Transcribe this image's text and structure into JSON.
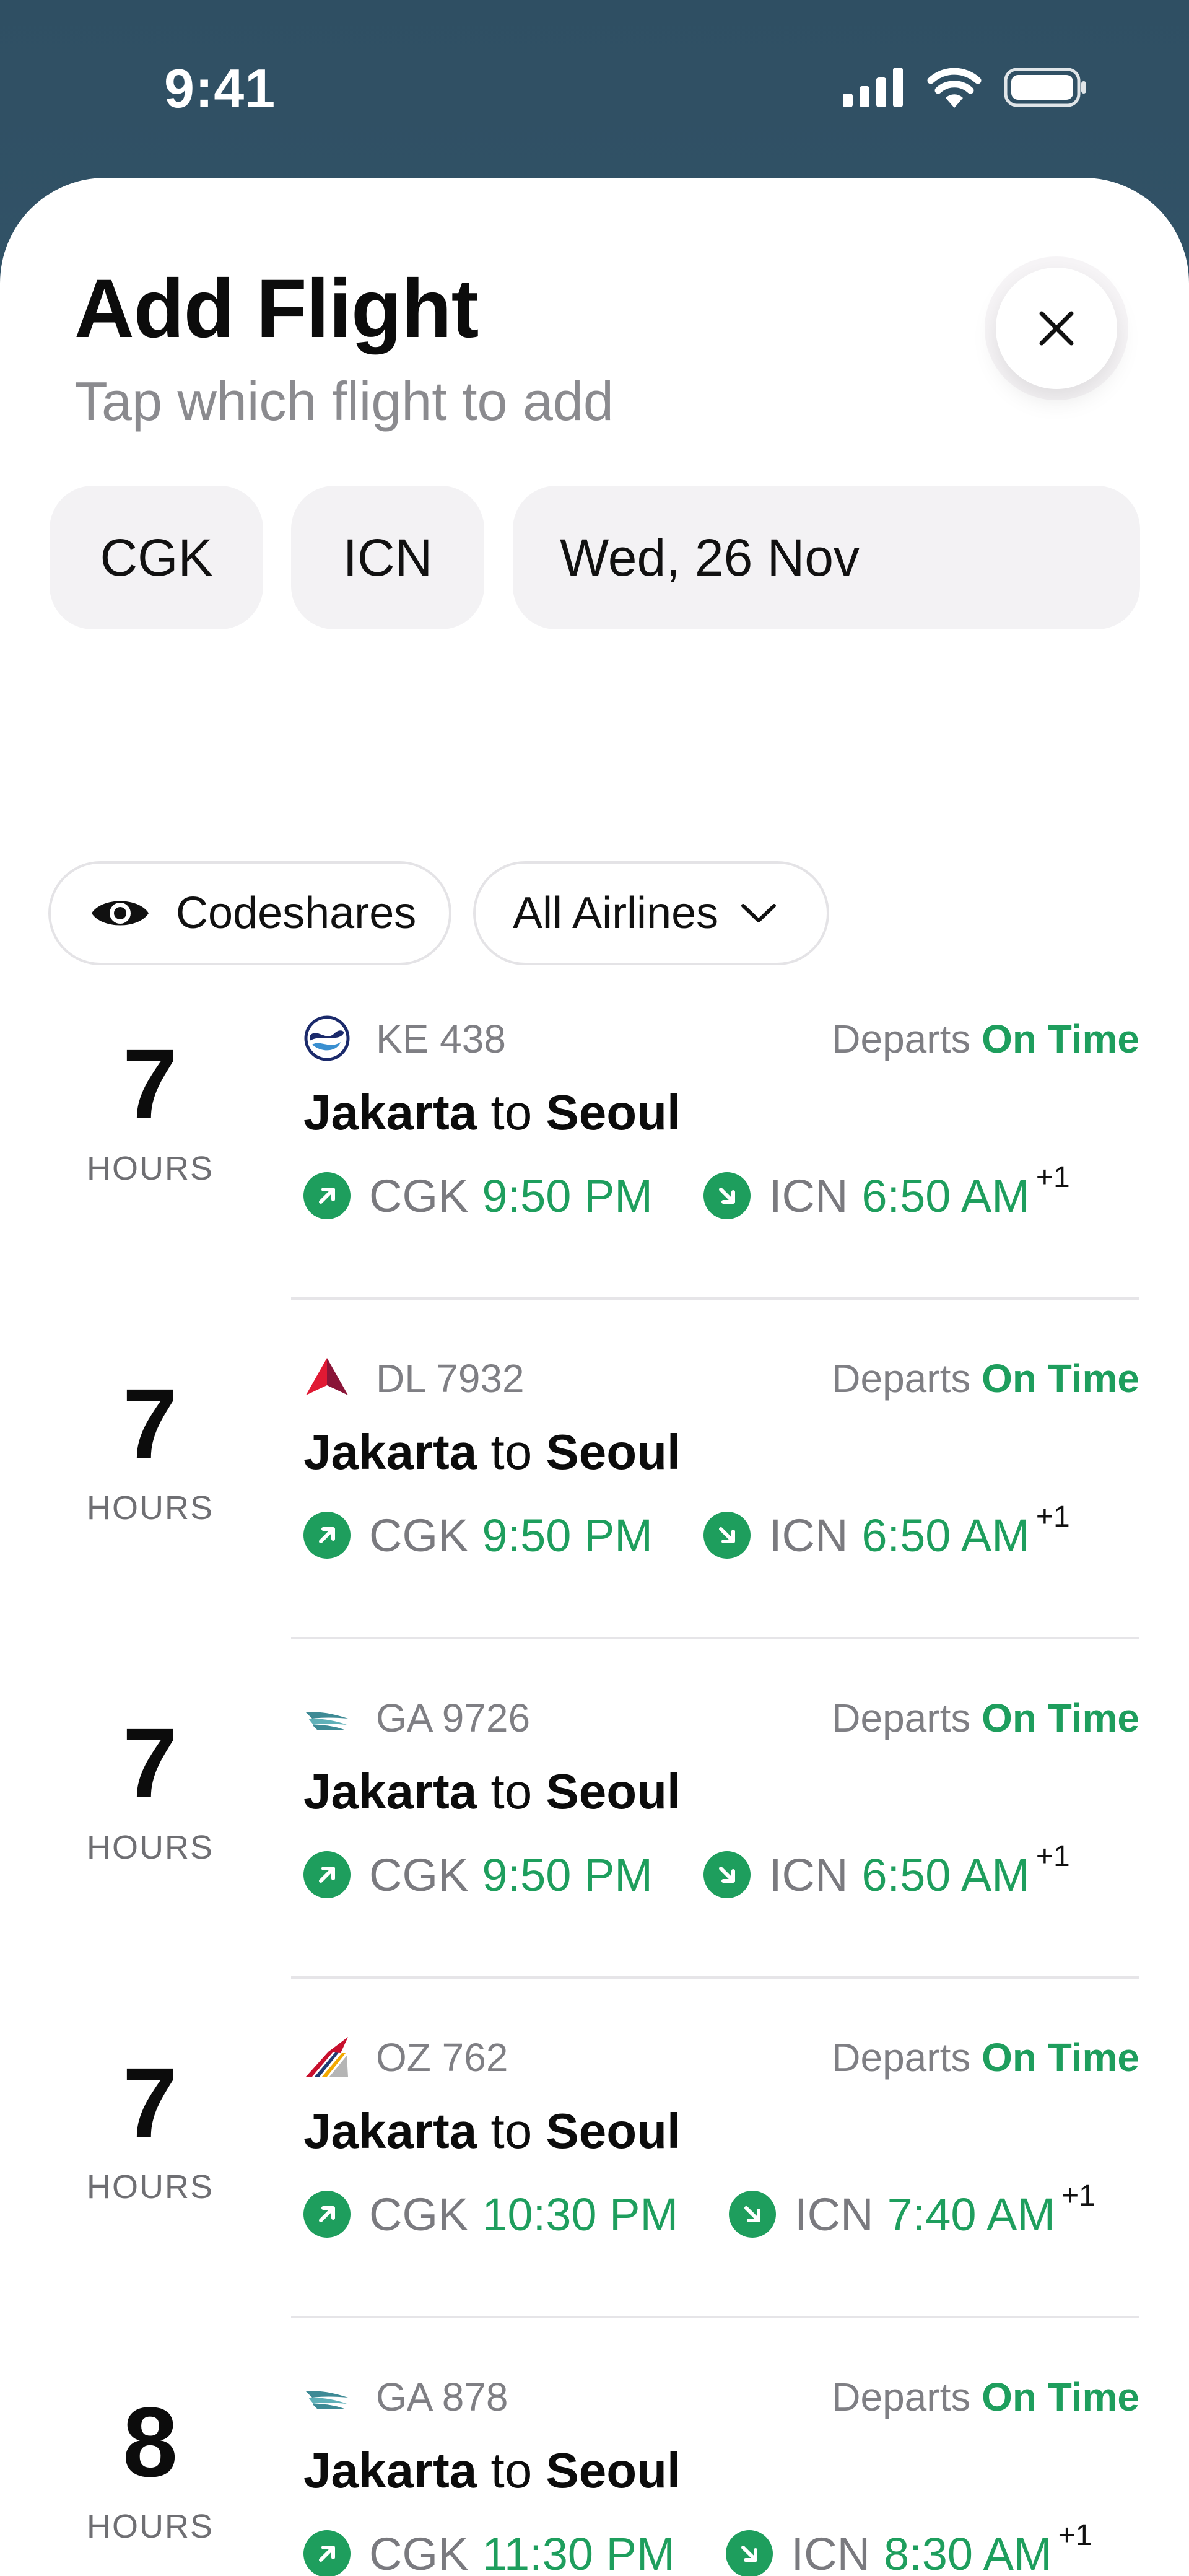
{
  "status_bar": {
    "time": "9:41",
    "icons": [
      "signal-icon",
      "wifi-icon",
      "battery-icon"
    ]
  },
  "sheet": {
    "title": "Add Flight",
    "subtitle": "Tap which flight to add",
    "close_icon": "close-icon"
  },
  "search": {
    "origin": "CGK",
    "destination": "ICN",
    "date": "Wed, 26 Nov"
  },
  "filters": {
    "codeshares_label": "Codeshares",
    "codeshares_icon": "eye-icon",
    "airlines_label": "All Airlines",
    "airlines_icon": "chevron-down-icon"
  },
  "colors": {
    "accent_green": "#1e9e5d",
    "muted_text": "#7f7f84",
    "chip_bg": "#f3f2f4"
  },
  "flights": [
    {
      "duration": "7",
      "duration_unit": "HOURS",
      "airline_logo": "korean-air-logo",
      "code": "KE 438",
      "status_prefix": "Departs",
      "status": "On Time",
      "from_city": "Jakarta",
      "to_word": "to",
      "to_city": "Seoul",
      "dep_airport": "CGK",
      "dep_time": "9:50 PM",
      "arr_airport": "ICN",
      "arr_time": "6:50 AM",
      "day_offset": "+1"
    },
    {
      "duration": "7",
      "duration_unit": "HOURS",
      "airline_logo": "delta-logo",
      "code": "DL 7932",
      "status_prefix": "Departs",
      "status": "On Time",
      "from_city": "Jakarta",
      "to_word": "to",
      "to_city": "Seoul",
      "dep_airport": "CGK",
      "dep_time": "9:50 PM",
      "arr_airport": "ICN",
      "arr_time": "6:50 AM",
      "day_offset": "+1"
    },
    {
      "duration": "7",
      "duration_unit": "HOURS",
      "airline_logo": "garuda-logo",
      "code": "GA 9726",
      "status_prefix": "Departs",
      "status": "On Time",
      "from_city": "Jakarta",
      "to_word": "to",
      "to_city": "Seoul",
      "dep_airport": "CGK",
      "dep_time": "9:50 PM",
      "arr_airport": "ICN",
      "arr_time": "6:50 AM",
      "day_offset": "+1"
    },
    {
      "duration": "7",
      "duration_unit": "HOURS",
      "airline_logo": "asiana-logo",
      "code": "OZ 762",
      "status_prefix": "Departs",
      "status": "On Time",
      "from_city": "Jakarta",
      "to_word": "to",
      "to_city": "Seoul",
      "dep_airport": "CGK",
      "dep_time": "10:30 PM",
      "arr_airport": "ICN",
      "arr_time": "7:40 AM",
      "day_offset": "+1"
    },
    {
      "duration": "8",
      "duration_unit": "HOURS",
      "airline_logo": "garuda-logo",
      "code": "GA 878",
      "status_prefix": "Departs",
      "status": "On Time",
      "from_city": "Jakarta",
      "to_word": "to",
      "to_city": "Seoul",
      "dep_airport": "CGK",
      "dep_time": "11:30 PM",
      "arr_airport": "ICN",
      "arr_time": "8:30 AM",
      "day_offset": "+1"
    }
  ]
}
